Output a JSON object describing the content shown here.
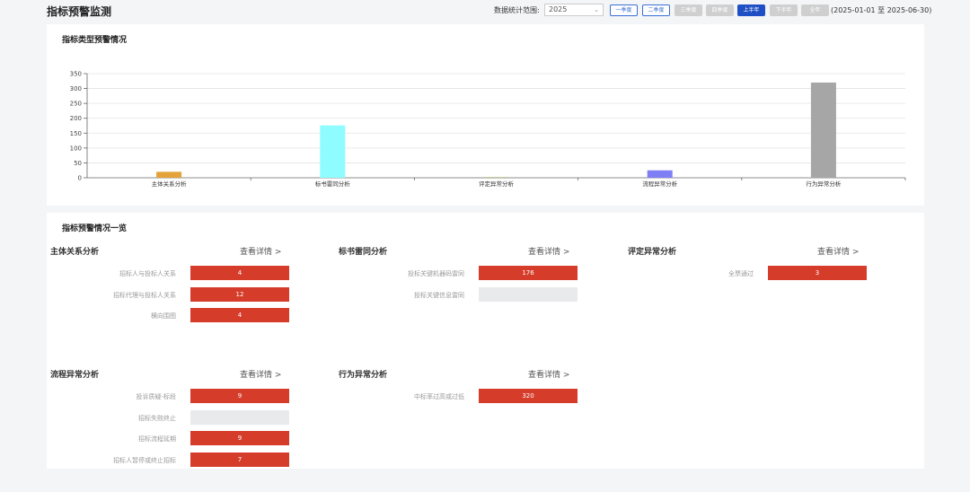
{
  "header": {
    "title": "指标预警监测",
    "range_label": "数据统计范围:",
    "year": "2025",
    "buttons": [
      {
        "label": "一季度",
        "state": "outline"
      },
      {
        "label": "二季度",
        "state": "outline"
      },
      {
        "label": "三季度",
        "state": "disabled"
      },
      {
        "label": "四季度",
        "state": "disabled"
      },
      {
        "label": "上半年",
        "state": "active"
      },
      {
        "label": "下半年",
        "state": "disabled"
      },
      {
        "label": "全年",
        "state": "disabled"
      }
    ],
    "date_range": "(2025-01-01 至 2025-06-30)"
  },
  "chart_section": {
    "title": "指标类型预警情况"
  },
  "chart_data": {
    "type": "bar",
    "categories": [
      "主体关系分析",
      "标书雷同分析",
      "评定异常分析",
      "流程异常分析",
      "行为异常分析"
    ],
    "values": [
      20,
      176,
      3,
      25,
      320
    ],
    "colors": [
      "#e3a33a",
      "#8ffcff",
      "#c8c8a0",
      "#7f7ff5",
      "#a6a6a6"
    ],
    "ylim": [
      0,
      350
    ],
    "yticks": [
      0,
      50,
      100,
      150,
      200,
      250,
      300,
      350
    ],
    "grid": true,
    "title": "",
    "xlabel": "",
    "ylabel": ""
  },
  "list_section": {
    "title": "指标预警情况一览",
    "groups": [
      {
        "title": "主体关系分析",
        "detail": "查看详情 >",
        "rows": [
          {
            "label": "招标人与投标人关系",
            "value": "4"
          },
          {
            "label": "招标代理与投标人关系",
            "value": "12"
          },
          {
            "label": "横向围图",
            "value": "4"
          }
        ]
      },
      {
        "title": "标书雷同分析",
        "detail": "查看详情 >",
        "rows": [
          {
            "label": "投标关键机器码雷同",
            "value": "176"
          },
          {
            "label": "投标关键信息雷同",
            "value": ""
          }
        ]
      },
      {
        "title": "评定异常分析",
        "detail": "查看详情 >",
        "rows": [
          {
            "label": "全票通过",
            "value": "3"
          }
        ]
      },
      {
        "title": "流程异常分析",
        "detail": "查看详情 >",
        "rows": [
          {
            "label": "投诉质疑-标段",
            "value": "9"
          },
          {
            "label": "招标失败终止",
            "value": ""
          },
          {
            "label": "招标流程延期",
            "value": "9"
          },
          {
            "label": "招标人暂停或终止招标",
            "value": "7"
          }
        ]
      },
      {
        "title": "行为异常分析",
        "detail": "查看详情 >",
        "rows": [
          {
            "label": "中标率过高或过低",
            "value": "320"
          }
        ]
      }
    ]
  }
}
